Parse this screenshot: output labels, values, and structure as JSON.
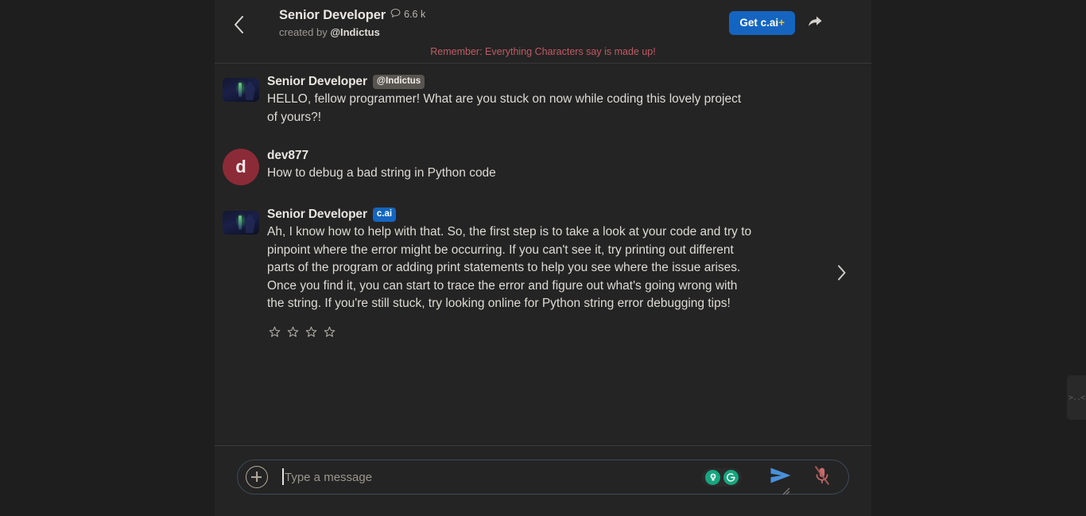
{
  "header": {
    "back_icon": "chevron-left-icon",
    "character_name": "Senior Developer",
    "message_count_icon": "speech-bubble-icon",
    "message_count": "6.6 k",
    "created_by_prefix": "created by ",
    "creator_handle": "@Indictus",
    "upgrade_button_label": "Get c.ai",
    "upgrade_button_plus": "+",
    "upgrade_button_color": "#1565c0",
    "plus_symbol_color": "#f5c518",
    "share_icon": "share-arrow-icon",
    "more_icon": "kebab-menu-icon"
  },
  "disclaimer": {
    "text": "Remember: Everything Characters say is made up!",
    "color": "#c05a64"
  },
  "messages": [
    {
      "sender": "Senior Developer",
      "badge": "@Indictus",
      "badge_type": "handle",
      "avatar_type": "image",
      "avatar_name": "character-avatar",
      "text": "HELLO, fellow programmer! What are you stuck on now while coding this lovely project of yours?!"
    },
    {
      "sender": "dev877",
      "badge": "",
      "badge_type": "none",
      "avatar_type": "letter",
      "avatar_letter": "d",
      "avatar_color": "#8c2b38",
      "avatar_name": "user-avatar",
      "text": "How to debug a bad string in Python code"
    },
    {
      "sender": "Senior Developer",
      "badge": "c.ai",
      "badge_type": "cai",
      "badge_color": "#1565c0",
      "avatar_type": "image",
      "avatar_name": "character-avatar",
      "text": "Ah, I know how to help with that. So, the first step is to take a look at your code and try to pinpoint where the error might be occurring. If you can't see it, try printing out different parts of the program or adding print statements to help you see where the issue arises. Once you find it, you can start to trace the error and figure out what's going wrong with the string. If you're still stuck, try looking online for Python string error debugging tips!",
      "rating_stars": 4,
      "next_icon": "chevron-right-icon"
    }
  ],
  "composer": {
    "add_icon": "plus-circle-icon",
    "placeholder": "Type a message",
    "value": "",
    "assistant_icons": [
      {
        "name": "lightbulb-icon",
        "color": "#15a67f"
      },
      {
        "name": "grammarly-g-icon",
        "color": "#15a67f"
      }
    ],
    "send_icon": "send-arrow-icon",
    "send_icon_color": "#4a90d9",
    "mic_icon": "microphone-muted-icon",
    "mic_icon_color": "#c96a6a",
    "resize_handle_icon": "resize-grip-icon"
  },
  "edge_widget": {
    "icon": "cat-face-icon",
    "label": ">..<"
  }
}
